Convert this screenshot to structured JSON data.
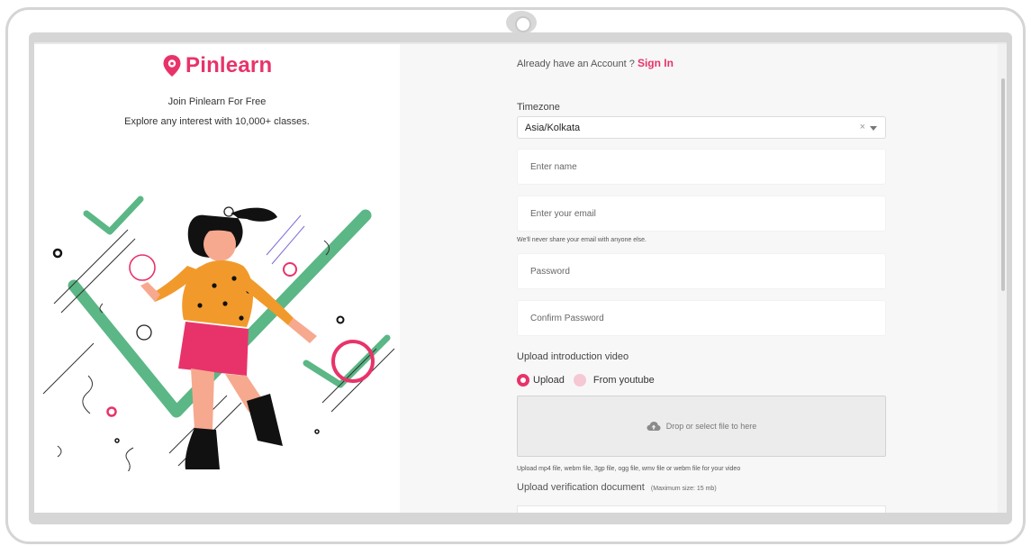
{
  "brand": {
    "name": "Pinlearn",
    "color": "#e8336a"
  },
  "left": {
    "join_text": "Join Pinlearn For Free",
    "explore_text": "Explore any interest with 10,000+ classes."
  },
  "header": {
    "already_text": "Already have an Account ?",
    "signin_label": "Sign In"
  },
  "form": {
    "timezone_label": "Timezone",
    "timezone_value": "Asia/Kolkata",
    "timezone_clear": "×",
    "name_placeholder": "Enter name",
    "email_placeholder": "Enter your email",
    "email_help": "We'll never share your email with anyone else.",
    "password_placeholder": "Password",
    "confirm_password_placeholder": "Confirm Password",
    "upload_video_label": "Upload introduction video",
    "radio_upload_label": "Upload",
    "radio_youtube_label": "From youtube",
    "dropzone_text": "Drop or select file to here",
    "video_help": "Upload mp4 file, webm file, 3gp file, ogg file, wmv file or webm file for your video",
    "verification_label": "Upload verification document",
    "verification_note": "(Maximum size: 15 mb)"
  },
  "icons": {
    "logo": "location-pin-icon",
    "dropzone": "cloud-upload-icon",
    "clear": "close-icon",
    "caret": "chevron-down-icon"
  },
  "colors": {
    "accent": "#e8336a",
    "illustration_green": "#5bb785",
    "illustration_orange": "#f19a2b"
  }
}
